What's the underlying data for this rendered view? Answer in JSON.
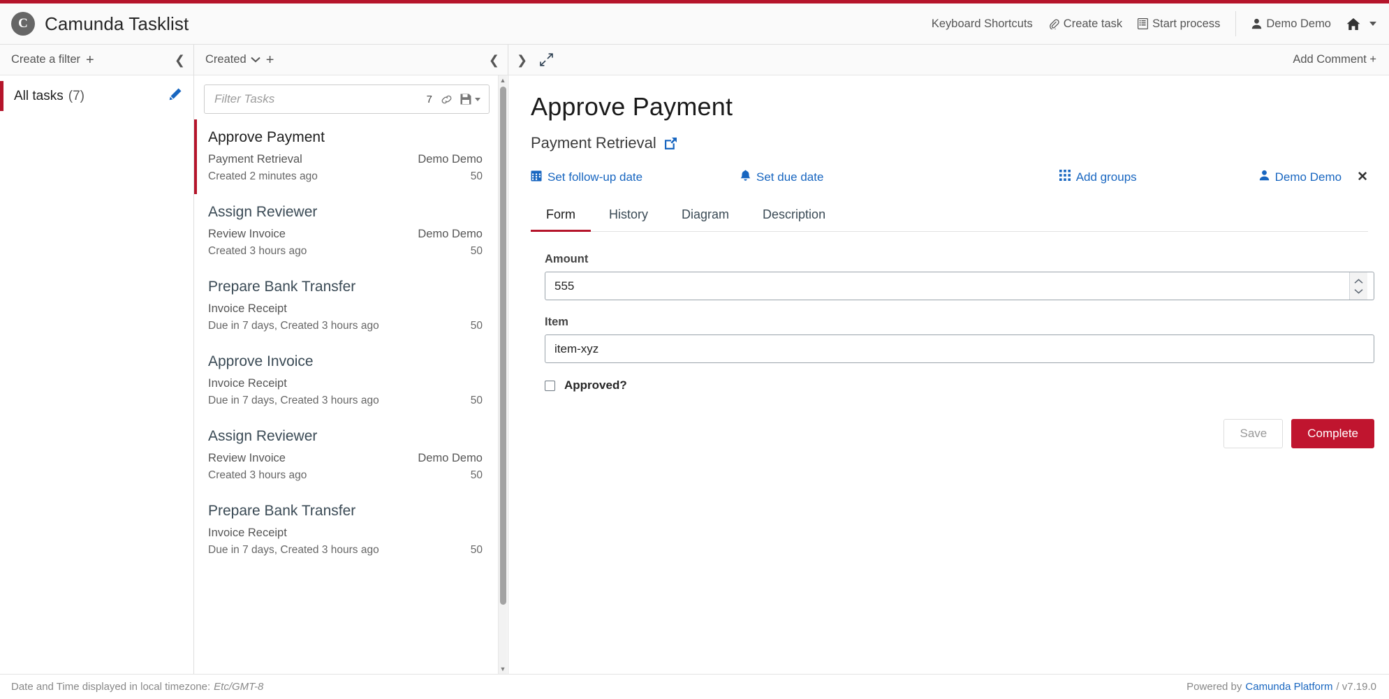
{
  "header": {
    "brand_mark": "C",
    "title": "Camunda Tasklist",
    "nav": [
      {
        "label": "Keyboard Shortcuts",
        "icon": ""
      },
      {
        "label": "Create task",
        "icon": "paperclip-icon"
      },
      {
        "label": "Start process",
        "icon": "list-document-icon"
      },
      {
        "label": "Demo Demo",
        "icon": "user-icon"
      }
    ],
    "home_icon": "home-icon"
  },
  "filters": {
    "head_label": "Create a filter",
    "head_plus": "+",
    "collapse_icon": "chevron-left-icon",
    "items": [
      {
        "label": "All tasks",
        "count": "(7)",
        "edit_icon": "pencil-icon"
      }
    ]
  },
  "tasklist": {
    "head_label": "Created",
    "head_caret": "chevron-down-icon",
    "head_plus": "+",
    "collapse_icon": "chevron-left-icon",
    "search": {
      "placeholder": "Filter Tasks",
      "count": "7",
      "link_icon": "chain-link-icon",
      "save_icon": "floppy-disk-icon"
    },
    "tasks": [
      {
        "title": "Approve Payment",
        "process": "Payment Retrieval",
        "assignee": "Demo Demo",
        "meta": "Created 2 minutes ago",
        "priority": "50",
        "selected": true
      },
      {
        "title": "Assign Reviewer",
        "process": "Review Invoice",
        "assignee": "Demo Demo",
        "meta": "Created 3 hours ago",
        "priority": "50",
        "selected": false
      },
      {
        "title": "Prepare Bank Transfer",
        "process": "Invoice Receipt",
        "assignee": "",
        "meta": "Due in 7 days, Created 3 hours ago",
        "priority": "50",
        "selected": false
      },
      {
        "title": "Approve Invoice",
        "process": "Invoice Receipt",
        "assignee": "",
        "meta": "Due in 7 days, Created 3 hours ago",
        "priority": "50",
        "selected": false
      },
      {
        "title": "Assign Reviewer",
        "process": "Review Invoice",
        "assignee": "Demo Demo",
        "meta": "Created 3 hours ago",
        "priority": "50",
        "selected": false
      },
      {
        "title": "Prepare Bank Transfer",
        "process": "Invoice Receipt",
        "assignee": "",
        "meta": "Due in 7 days, Created 3 hours ago",
        "priority": "50",
        "selected": false
      }
    ]
  },
  "detail": {
    "expand_left_icon": "chevron-right-icon",
    "maximize_icon": "expand-arrows-icon",
    "add_comment": "Add Comment +",
    "title": "Approve Payment",
    "process_name": "Payment Retrieval",
    "process_link_icon": "external-link-icon",
    "actions": {
      "follow_up": "Set follow-up date",
      "follow_up_icon": "calendar-icon",
      "due": "Set due date",
      "due_icon": "bell-icon",
      "groups": "Add groups",
      "groups_icon": "grid-icon",
      "assignee": "Demo Demo",
      "assignee_icon": "user-icon",
      "assignee_remove": "✕"
    },
    "tabs": [
      {
        "label": "Form",
        "active": true
      },
      {
        "label": "History",
        "active": false
      },
      {
        "label": "Diagram",
        "active": false
      },
      {
        "label": "Description",
        "active": false
      }
    ],
    "form": {
      "amount_label": "Amount",
      "amount_value": "555",
      "amount_spinner": "number-stepper",
      "item_label": "Item",
      "item_value": "item-xyz",
      "approved_label": "Approved?",
      "approved_checked": false,
      "save_label": "Save",
      "complete_label": "Complete"
    }
  },
  "footer": {
    "timezone_prefix": "Date and Time displayed in local timezone:",
    "timezone": "Etc/GMT-8",
    "powered_prefix": "Powered by",
    "powered_link": "Camunda Platform",
    "version": "/ v7.19.0"
  },
  "colors": {
    "brand_red": "#b5152b",
    "complete_red": "#c0152f",
    "link_blue": "#1866c0"
  }
}
